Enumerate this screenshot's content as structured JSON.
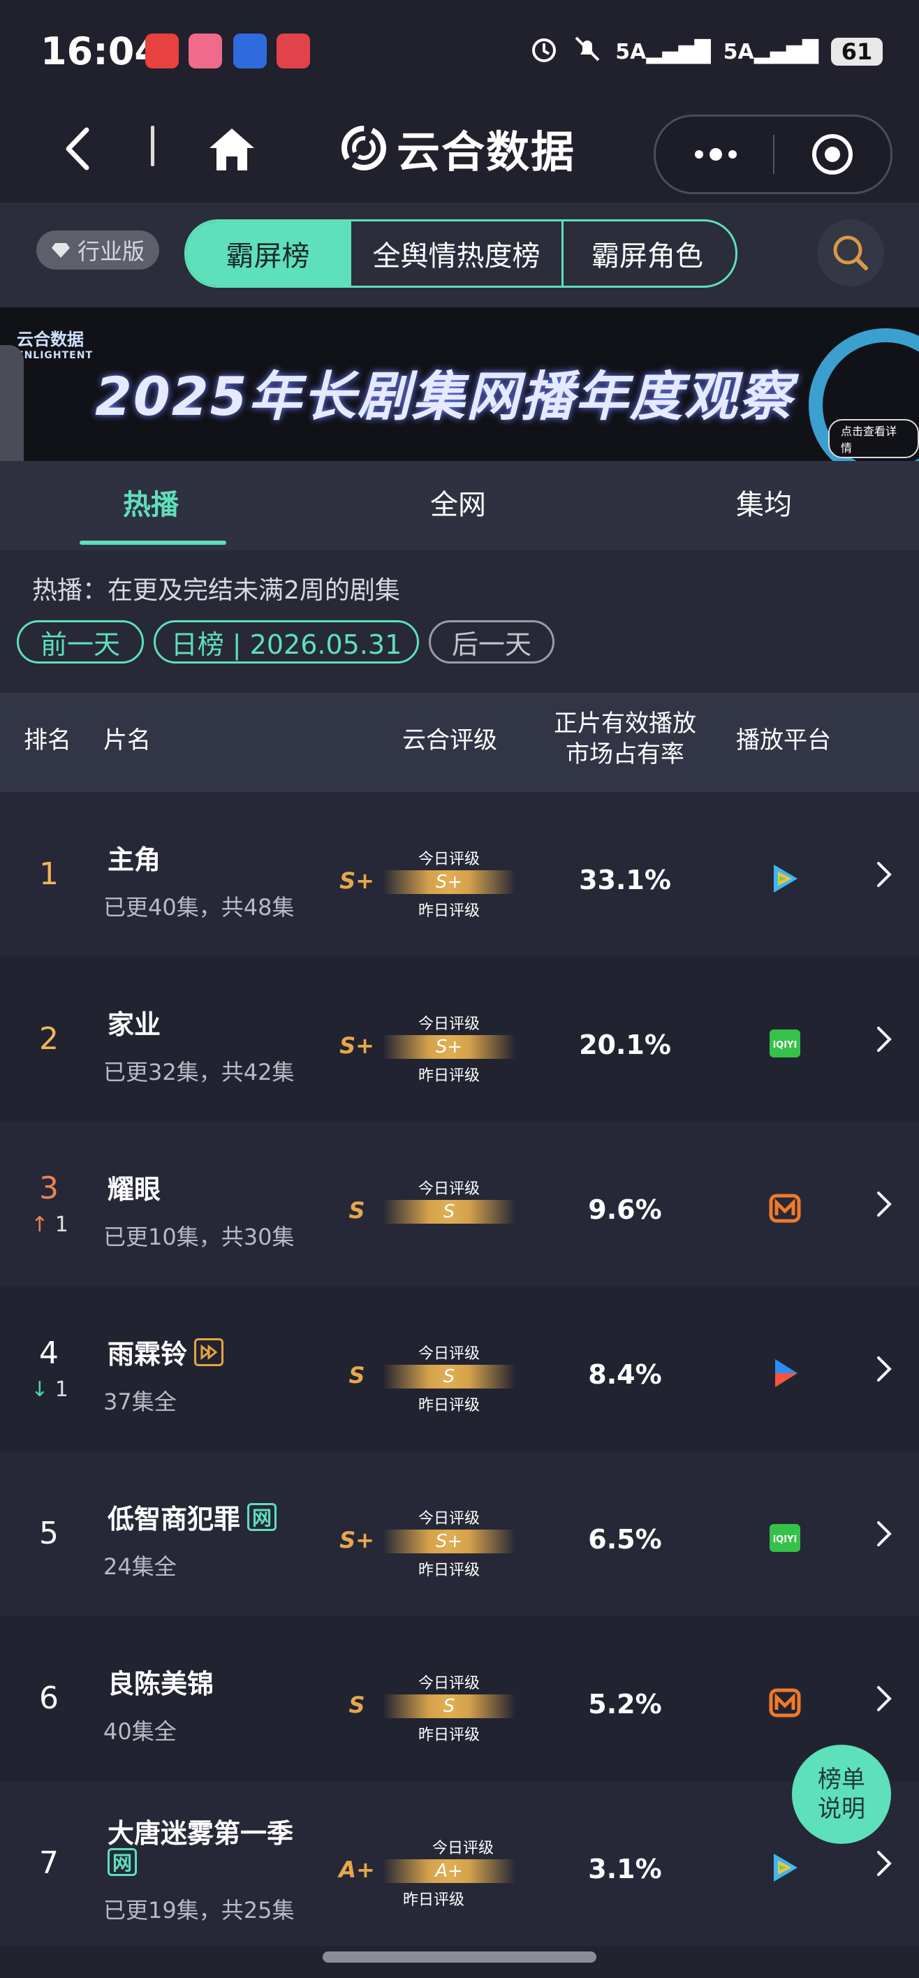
{
  "status_bar": {
    "time": "16:04",
    "apps": [
      {
        "icon": "app-gallery-icon",
        "label": "App Gallery",
        "color": "#e8413f"
      },
      {
        "icon": "bilibili-icon",
        "label": "bilibili",
        "color": "#f06a8b"
      },
      {
        "icon": "security-app-icon",
        "label": "",
        "color": "#2f6bdc"
      },
      {
        "icon": "book-app-icon",
        "label": "",
        "color": "#e2434a"
      }
    ],
    "signal1": "5A",
    "signal2": "5A",
    "battery": "61"
  },
  "nav": {
    "brand": "云合数据"
  },
  "tabs": {
    "industry": "行业版",
    "segments": [
      "霸屏榜",
      "全舆情热度榜",
      "霸屏角色"
    ],
    "active_index": 0
  },
  "banner": {
    "logo": "云合数据",
    "logo_en": "ENLIGHTENT",
    "title": "2025年长剧集网播年度观察",
    "cta": "点击查看详情"
  },
  "sub_tabs": {
    "items": [
      "热播",
      "全网",
      "集均"
    ],
    "active_index": 0
  },
  "filter": {
    "hint": "热播：在更及完结未满2周的剧集",
    "prev": "前一天",
    "current": "日榜 | 2026.05.31",
    "next": "后一天"
  },
  "table": {
    "headers": {
      "rank": "排名",
      "name": "片名",
      "grade": "云合评级",
      "share_line1": "正片有效播放",
      "share_line2": "市场占有率",
      "platform": "播放平台"
    },
    "today_label": "今日评级",
    "yesterday_label": "昨日评级",
    "rows": [
      {
        "rank": "1",
        "title": "主角",
        "tag": "",
        "meta": "已更40集，共48集",
        "grade": "S+",
        "grade_bar": "S+",
        "share": "33.1%",
        "platform": "tencent-video-icon",
        "trend_arrow": "",
        "trend_value": ""
      },
      {
        "rank": "2",
        "title": "家业",
        "tag": "",
        "meta": "已更32集，共42集",
        "grade": "S+",
        "grade_bar": "S+",
        "share": "20.1%",
        "platform": "iqiyi-icon",
        "trend_arrow": "",
        "trend_value": ""
      },
      {
        "rank": "3",
        "title": "耀眼",
        "tag": "",
        "meta": "已更10集，共30集",
        "grade": "S",
        "grade_bar": "S",
        "share": "9.6%",
        "platform": "mango-tv-icon",
        "trend_arrow": "↑",
        "trend_value": "1"
      },
      {
        "rank": "4",
        "title": "雨霖铃",
        "tag": "dup",
        "meta": "37集全",
        "grade": "S",
        "grade_bar": "S",
        "share": "8.4%",
        "platform": "youku-icon",
        "trend_arrow": "↓",
        "trend_value": "1"
      },
      {
        "rank": "5",
        "title": "低智商犯罪",
        "tag": "网",
        "meta": "24集全",
        "grade": "S+",
        "grade_bar": "S+",
        "share": "6.5%",
        "platform": "iqiyi-icon",
        "trend_arrow": "",
        "trend_value": ""
      },
      {
        "rank": "6",
        "title": "良陈美锦",
        "tag": "",
        "meta": "40集全",
        "grade": "S",
        "grade_bar": "S",
        "share": "5.2%",
        "platform": "mango-tv-icon",
        "trend_arrow": "",
        "trend_value": ""
      },
      {
        "rank": "7",
        "title": "大唐迷雾第一季",
        "tag": "网",
        "meta": "已更19集，共25集",
        "grade": "A+",
        "grade_bar": "A+",
        "share": "3.1%",
        "platform": "tencent-video-icon",
        "trend_arrow": "",
        "trend_value": ""
      }
    ]
  },
  "help": {
    "line1": "榜单",
    "line2": "说明"
  },
  "colors": {
    "accent": "#5ee0ba",
    "gold": "#e5a94a",
    "background": "#22232f"
  }
}
